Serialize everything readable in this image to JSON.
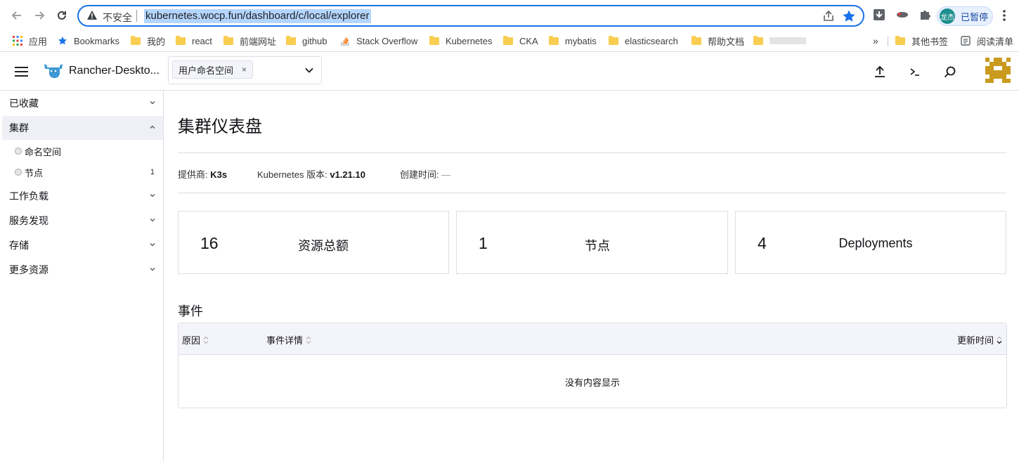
{
  "browser": {
    "insecure_label": "不安全",
    "url": "kubernetes.wocp.fun/dashboard/c/local/explorer",
    "profile_initials": "龙杰",
    "profile_status": "已暂停"
  },
  "bookmarks": {
    "items": [
      "应用",
      "Bookmarks",
      "我的",
      "react",
      "前端网址",
      "github",
      "Stack Overflow",
      "Kubernetes",
      "CKA",
      "mybatis",
      "elasticsearch",
      "帮助文档"
    ],
    "more_label": "»",
    "other": "其他书签",
    "reading": "阅读清单"
  },
  "header": {
    "cluster_name": "Rancher-Deskto...",
    "namespace_chip": "用户命名空间",
    "chip_remove": "×"
  },
  "sidebar": {
    "groups": [
      {
        "label": "已收藏"
      },
      {
        "label": "集群"
      },
      {
        "label": "工作负载"
      },
      {
        "label": "服务发现"
      },
      {
        "label": "存储"
      },
      {
        "label": "更多资源"
      }
    ],
    "cluster_items": [
      {
        "label": "命名空间",
        "count": ""
      },
      {
        "label": "节点",
        "count": "1"
      }
    ]
  },
  "main": {
    "title": "集群仪表盘",
    "provider_label": "提供商:",
    "provider_value": "K3s",
    "k8s_label": "Kubernetes 版本:",
    "k8s_value": "v1.21.10",
    "created_label": "创建时间:",
    "created_value": "—",
    "cards": [
      {
        "value": "16",
        "label": "资源总额"
      },
      {
        "value": "1",
        "label": "节点"
      },
      {
        "value": "4",
        "label": "Deployments"
      }
    ],
    "events_title": "事件",
    "columns": [
      "原因",
      "事件详情",
      "更新时间"
    ],
    "empty_text": "没有内容显示"
  },
  "colors": {
    "accent": "#1a73e8",
    "rancher_blue": "#3d98d3",
    "avatar_gold": "#c99a1e"
  }
}
